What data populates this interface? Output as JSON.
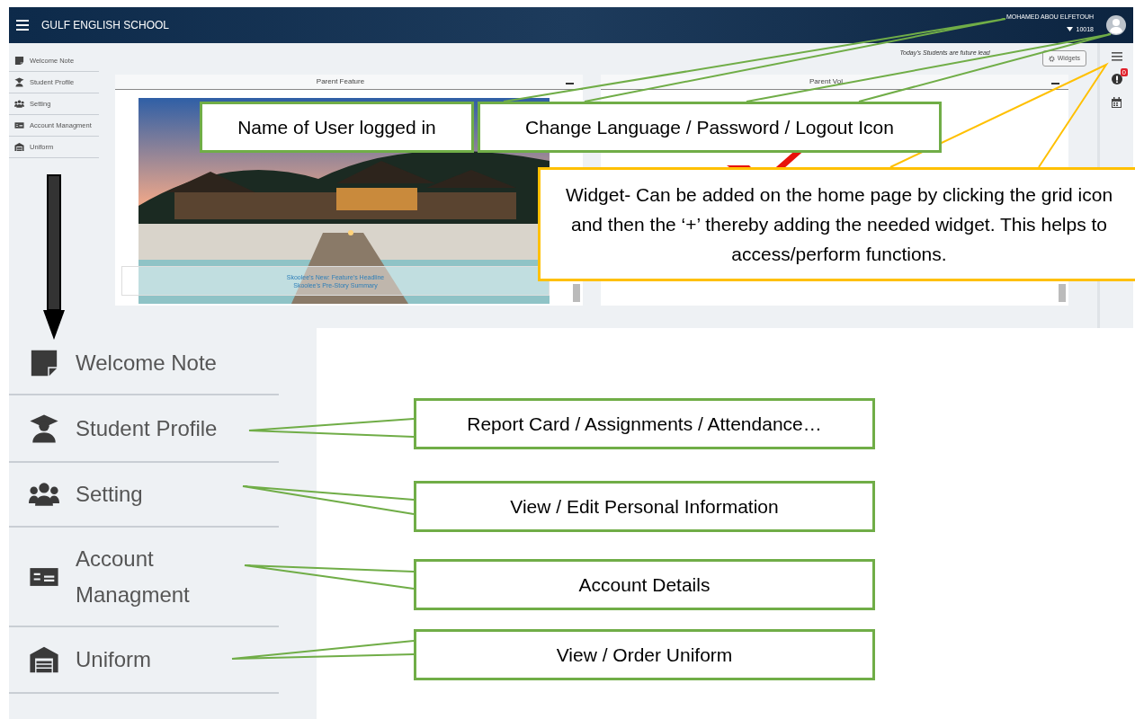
{
  "header": {
    "title": "GULF ENGLISH SCHOOL",
    "user_name": "MOHAMED ABOU ELFETOUH",
    "user_id": "10018"
  },
  "sidebar": {
    "items": [
      {
        "label": "Welcome Note",
        "kind": "note"
      },
      {
        "label": "Student Profile",
        "kind": "graduate"
      },
      {
        "label": "Setting",
        "kind": "users"
      },
      {
        "label": "Account Managment",
        "kind": "money"
      },
      {
        "label": "Uniform",
        "kind": "warehouse"
      }
    ]
  },
  "tagline": "Today's Students are future lead",
  "widgets_button": "Widgets",
  "panels": [
    {
      "title": "Parent Feature",
      "kind": "feature",
      "headline": "Skoolee's New: Feature's Headline",
      "summary": "Skoolee's Pre-Story Summary"
    },
    {
      "title": "Parent Vol",
      "kind": "logo"
    }
  ],
  "side_tools": [
    {
      "kind": "menu"
    },
    {
      "kind": "alert",
      "badge": "0"
    },
    {
      "kind": "calendar"
    }
  ],
  "callouts": [
    {
      "text": "Name of User logged in",
      "color": "#70ad47"
    },
    {
      "text": "Change Language / Password / Logout Icon",
      "color": "#70ad47"
    },
    {
      "text": "Widget- Can be added on the home page by clicking the grid icon and then the ‘+’ thereby adding the needed widget. This helps to access/perform functions.",
      "color": "#ffc000"
    }
  ],
  "zoomed_sidebar": {
    "items": [
      {
        "label": "Welcome Note",
        "kind": "note"
      },
      {
        "label": "Student Profile",
        "kind": "graduate"
      },
      {
        "label": "Setting",
        "kind": "users"
      },
      {
        "label": "Account Managment",
        "kind": "money"
      },
      {
        "label": "Uniform",
        "kind": "warehouse"
      }
    ]
  },
  "zoomed_callouts": [
    {
      "text": "Report Card / Assignments / Attendance…",
      "color": "#70ad47"
    },
    {
      "text": "View / Edit Personal Information",
      "color": "#70ad47"
    },
    {
      "text": "Account Details",
      "color": "#70ad47"
    },
    {
      "text": "View / Order Uniform",
      "color": "#70ad47"
    }
  ]
}
